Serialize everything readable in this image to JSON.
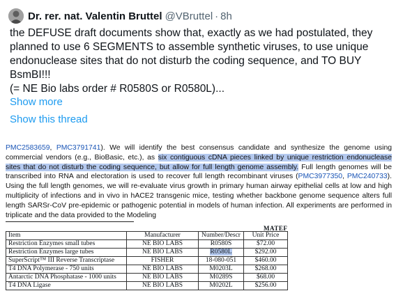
{
  "tweet": {
    "author_name": "Dr. rer. nat. Valentin Bruttel",
    "handle": "@VBruttel",
    "separator": "·",
    "time": "8h",
    "text": "the DEFUSE draft documents show that, exactly as we had postulated, they planned to use 6 SEGMENTS to assemble synthetic viruses, to use unique endonuclease sites that do not disturb the coding sequence, and TO BUY BsmBI!!!\n(= NE Bio labs order # R0580S or R0580L)...",
    "show_more": "Show more",
    "show_thread": "Show this thread"
  },
  "document": {
    "ref1": "PMC2583659",
    "sep1": ", ",
    "ref2": "PMC3791741",
    "p1": "). We will identify the best consensus candidate and synthesize the genome using commercial vendors (e.g., BioBasic, etc.), as ",
    "highlight": "six contiguous cDNA pieces linked by unique restriction endonuclease sites that do not disturb the coding sequence, but allow for full length genome assembly.",
    "p2": " Full length genomes will be transcribed into RNA and electoration is used to recover full length recombinant viruses (",
    "ref3": "PMC3977350",
    "sep2": ", ",
    "ref4": "PMC240733",
    "p3": "). Using the full length genomes, we will re-evaluate virus growth in primary human airway epithelial cells at low and high multiplicity of infections and in vivo in hACE2 transgenic mice, testing whether backbone genome sequence alters full length SARSr-CoV pre-epidemic or pathogenic potential in models of human infection. All experiments are performed in triplicate and the data provided to the Modeling",
    "table_heading": "MATEF",
    "table": {
      "headers": [
        "Item",
        "Manufacturer",
        "Number/Descr",
        "Unit Price"
      ],
      "rows": [
        [
          "Restriction Enzymes small tubes",
          "NE BIO LABS",
          "R0580S",
          "$72.00"
        ],
        [
          "Restriction Enzymes large tubes",
          "NE BIO LABS",
          "R0580L",
          "$292.00"
        ],
        [
          "SuperScript™ III Reverse Transcriptase",
          "FISHER",
          "18-080-051",
          "$460.00"
        ],
        [
          "T4 DNA Polymerase - 750 units",
          "NE BIO LABS",
          "M0203L",
          "$268.00"
        ],
        [
          "Antarctic DNA Phosphatase - 1000 units",
          "NE BIO LABS",
          "M0289S",
          "$68.00"
        ],
        [
          "T4 DNA Ligase",
          "NE BIO LABS",
          "M0202L",
          "$256.00"
        ]
      ]
    }
  },
  "colors": {
    "link": "#1d9bf0",
    "highlight": "#b4c9ef",
    "ref_link": "#1a55b6"
  }
}
